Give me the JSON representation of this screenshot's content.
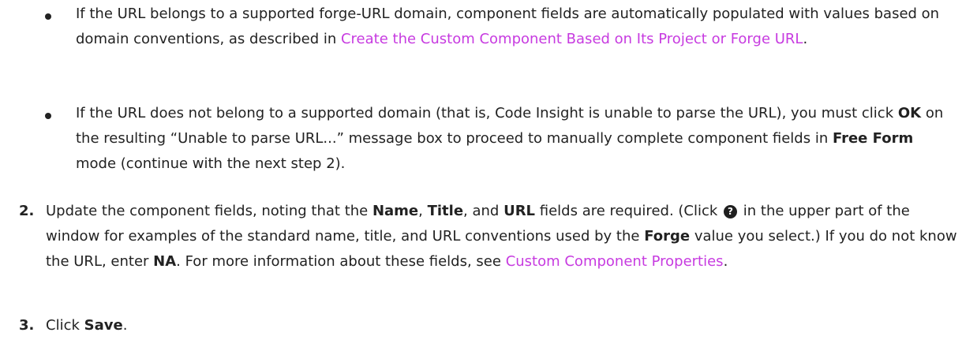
{
  "bullets": [
    {
      "text_1": "If the URL belongs to a supported forge-URL domain, component fields are automatically populated with values based on domain conventions, as described in ",
      "link": "Create the Custom Component Based on Its Project or Forge URL",
      "text_2": "."
    },
    {
      "text_1": "If the URL does not belong to a supported domain (that is, Code Insight is unable to parse the URL), you must click ",
      "bold_ok": "OK",
      "text_2": " on the resulting “Unable to parse URL...” message box to proceed to manually complete component fields in ",
      "bold_free_form": "Free Form",
      "text_3": " mode (continue with the next step 2)."
    }
  ],
  "steps": [
    {
      "number": "2.",
      "text_1": "Update the component fields, noting that the ",
      "bold_name": "Name",
      "text_2": ", ",
      "bold_title": "Title",
      "text_3": ", and ",
      "bold_url": "URL",
      "text_4": " fields are required. (Click ",
      "help_icon_glyph": "?",
      "text_5": " in the upper part of the window for examples of the standard name, title, and URL conventions used by the ",
      "bold_forge": "Forge",
      "text_6": " value you select.) If you do not know the URL, enter ",
      "bold_na": "NA",
      "text_7": ". For more information about these fields, see ",
      "link": "Custom Component Properties",
      "text_8": "."
    },
    {
      "number": "3.",
      "text_1": "Click ",
      "bold_save": "Save",
      "text_2": "."
    }
  ],
  "colors": {
    "link": "#c73be0",
    "text": "#222222"
  },
  "icons": {
    "help": "question-circle-icon"
  }
}
